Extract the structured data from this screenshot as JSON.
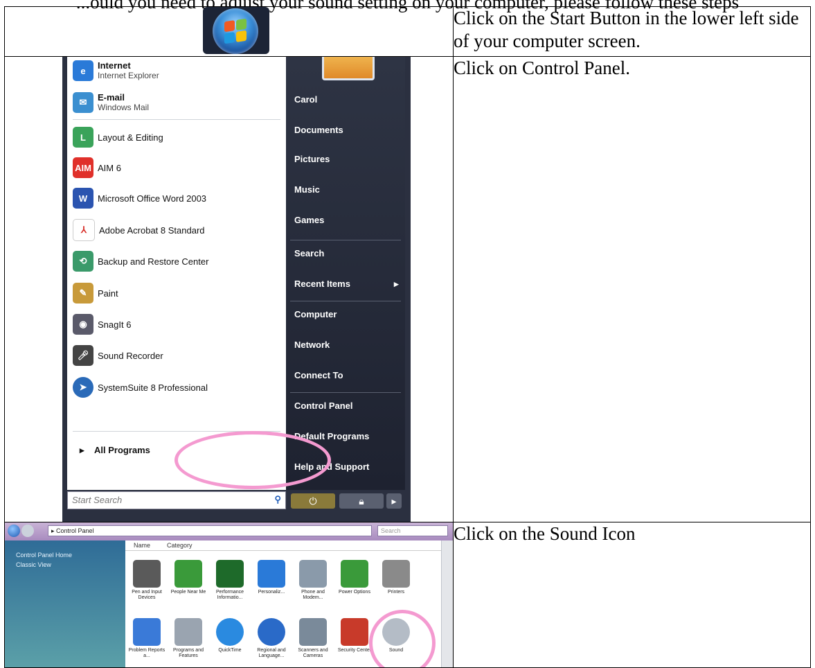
{
  "document": {
    "title_partial": "...ould you need to adjust your sound setting on your computer, please follow these steps",
    "steps": [
      {
        "instruction": "Click on the Start Button in the lower left side of your computer screen."
      },
      {
        "instruction": "Click on Control Panel."
      },
      {
        "instruction": "Click on the Sound Icon"
      }
    ]
  },
  "start_menu": {
    "pinned": [
      {
        "name": "Internet",
        "sub": "Internet Explorer",
        "icon": "internet-explorer-icon",
        "color": "#2a7ad8"
      },
      {
        "name": "E-mail",
        "sub": "Windows Mail",
        "icon": "windows-mail-icon",
        "color": "#3b8fd0"
      }
    ],
    "recent": [
      {
        "label": "Layout & Editing",
        "icon": "layout-editing-icon",
        "color": "#3aa35a"
      },
      {
        "label": "AIM 6",
        "icon": "aim-icon",
        "color": "#e0302a"
      },
      {
        "label": "Microsoft Office Word 2003",
        "icon": "word-icon",
        "color": "#2b54b0"
      },
      {
        "label": "Adobe Acrobat 8 Standard",
        "icon": "acrobat-icon",
        "color": "#d8302a"
      },
      {
        "label": "Backup and Restore Center",
        "icon": "backup-icon",
        "color": "#3a9a6a"
      },
      {
        "label": "Paint",
        "icon": "paint-icon",
        "color": "#c89a3a"
      },
      {
        "label": "SnagIt 6",
        "icon": "snagit-icon",
        "color": "#5a5a6a"
      },
      {
        "label": "Sound Recorder",
        "icon": "microphone-icon",
        "color": "#444444"
      },
      {
        "label": "SystemSuite 8 Professional",
        "icon": "systemsuite-icon",
        "color": "#2a6ab8"
      }
    ],
    "all_programs": "All Programs",
    "search_placeholder": "Start Search",
    "right_items": [
      "Carol",
      "Documents",
      "Pictures",
      "Music",
      "Games",
      "Search",
      "Recent Items",
      "Computer",
      "Network",
      "Connect To",
      "Control Panel",
      "Default Programs",
      "Help and Support"
    ]
  },
  "control_panel": {
    "address": "Control Panel",
    "search_placeholder": "Search",
    "sidebar": [
      "Control Panel Home",
      "Classic View"
    ],
    "columns": [
      "Name",
      "Category"
    ],
    "icons_row1": [
      {
        "label": "Pen and Input Devices",
        "icon": "pen-icon",
        "color": "#5a5a5a"
      },
      {
        "label": "People Near Me",
        "icon": "people-icon",
        "color": "#3a9a3a"
      },
      {
        "label": "Performance Informatio...",
        "icon": "performance-icon",
        "color": "#1e6a2a"
      },
      {
        "label": "Personaliz...",
        "icon": "personalize-icon",
        "color": "#2a7ad8"
      },
      {
        "label": "Phone and Modem...",
        "icon": "phone-icon",
        "color": "#8a9aaa"
      },
      {
        "label": "Power Options",
        "icon": "power-icon",
        "color": "#3a9a3a"
      },
      {
        "label": "Printers",
        "icon": "printer-icon",
        "color": "#8a8a8a"
      }
    ],
    "icons_row2": [
      {
        "label": "Problem Reports a...",
        "icon": "problem-reports-icon",
        "color": "#3a7ad8"
      },
      {
        "label": "Programs and Features",
        "icon": "programs-icon",
        "color": "#9aa4b0"
      },
      {
        "label": "QuickTime",
        "icon": "quicktime-icon",
        "color": "#2a8ae0"
      },
      {
        "label": "Regional and Language...",
        "icon": "globe-icon",
        "color": "#2a6ac8"
      },
      {
        "label": "Scanners and Cameras",
        "icon": "scanner-icon",
        "color": "#7a8a9a"
      },
      {
        "label": "Security Center",
        "icon": "shield-icon",
        "color": "#c83a2a"
      },
      {
        "label": "Sound",
        "icon": "speaker-icon",
        "color": "#b4bcc6"
      }
    ]
  },
  "highlight_color": "#f49ad0"
}
